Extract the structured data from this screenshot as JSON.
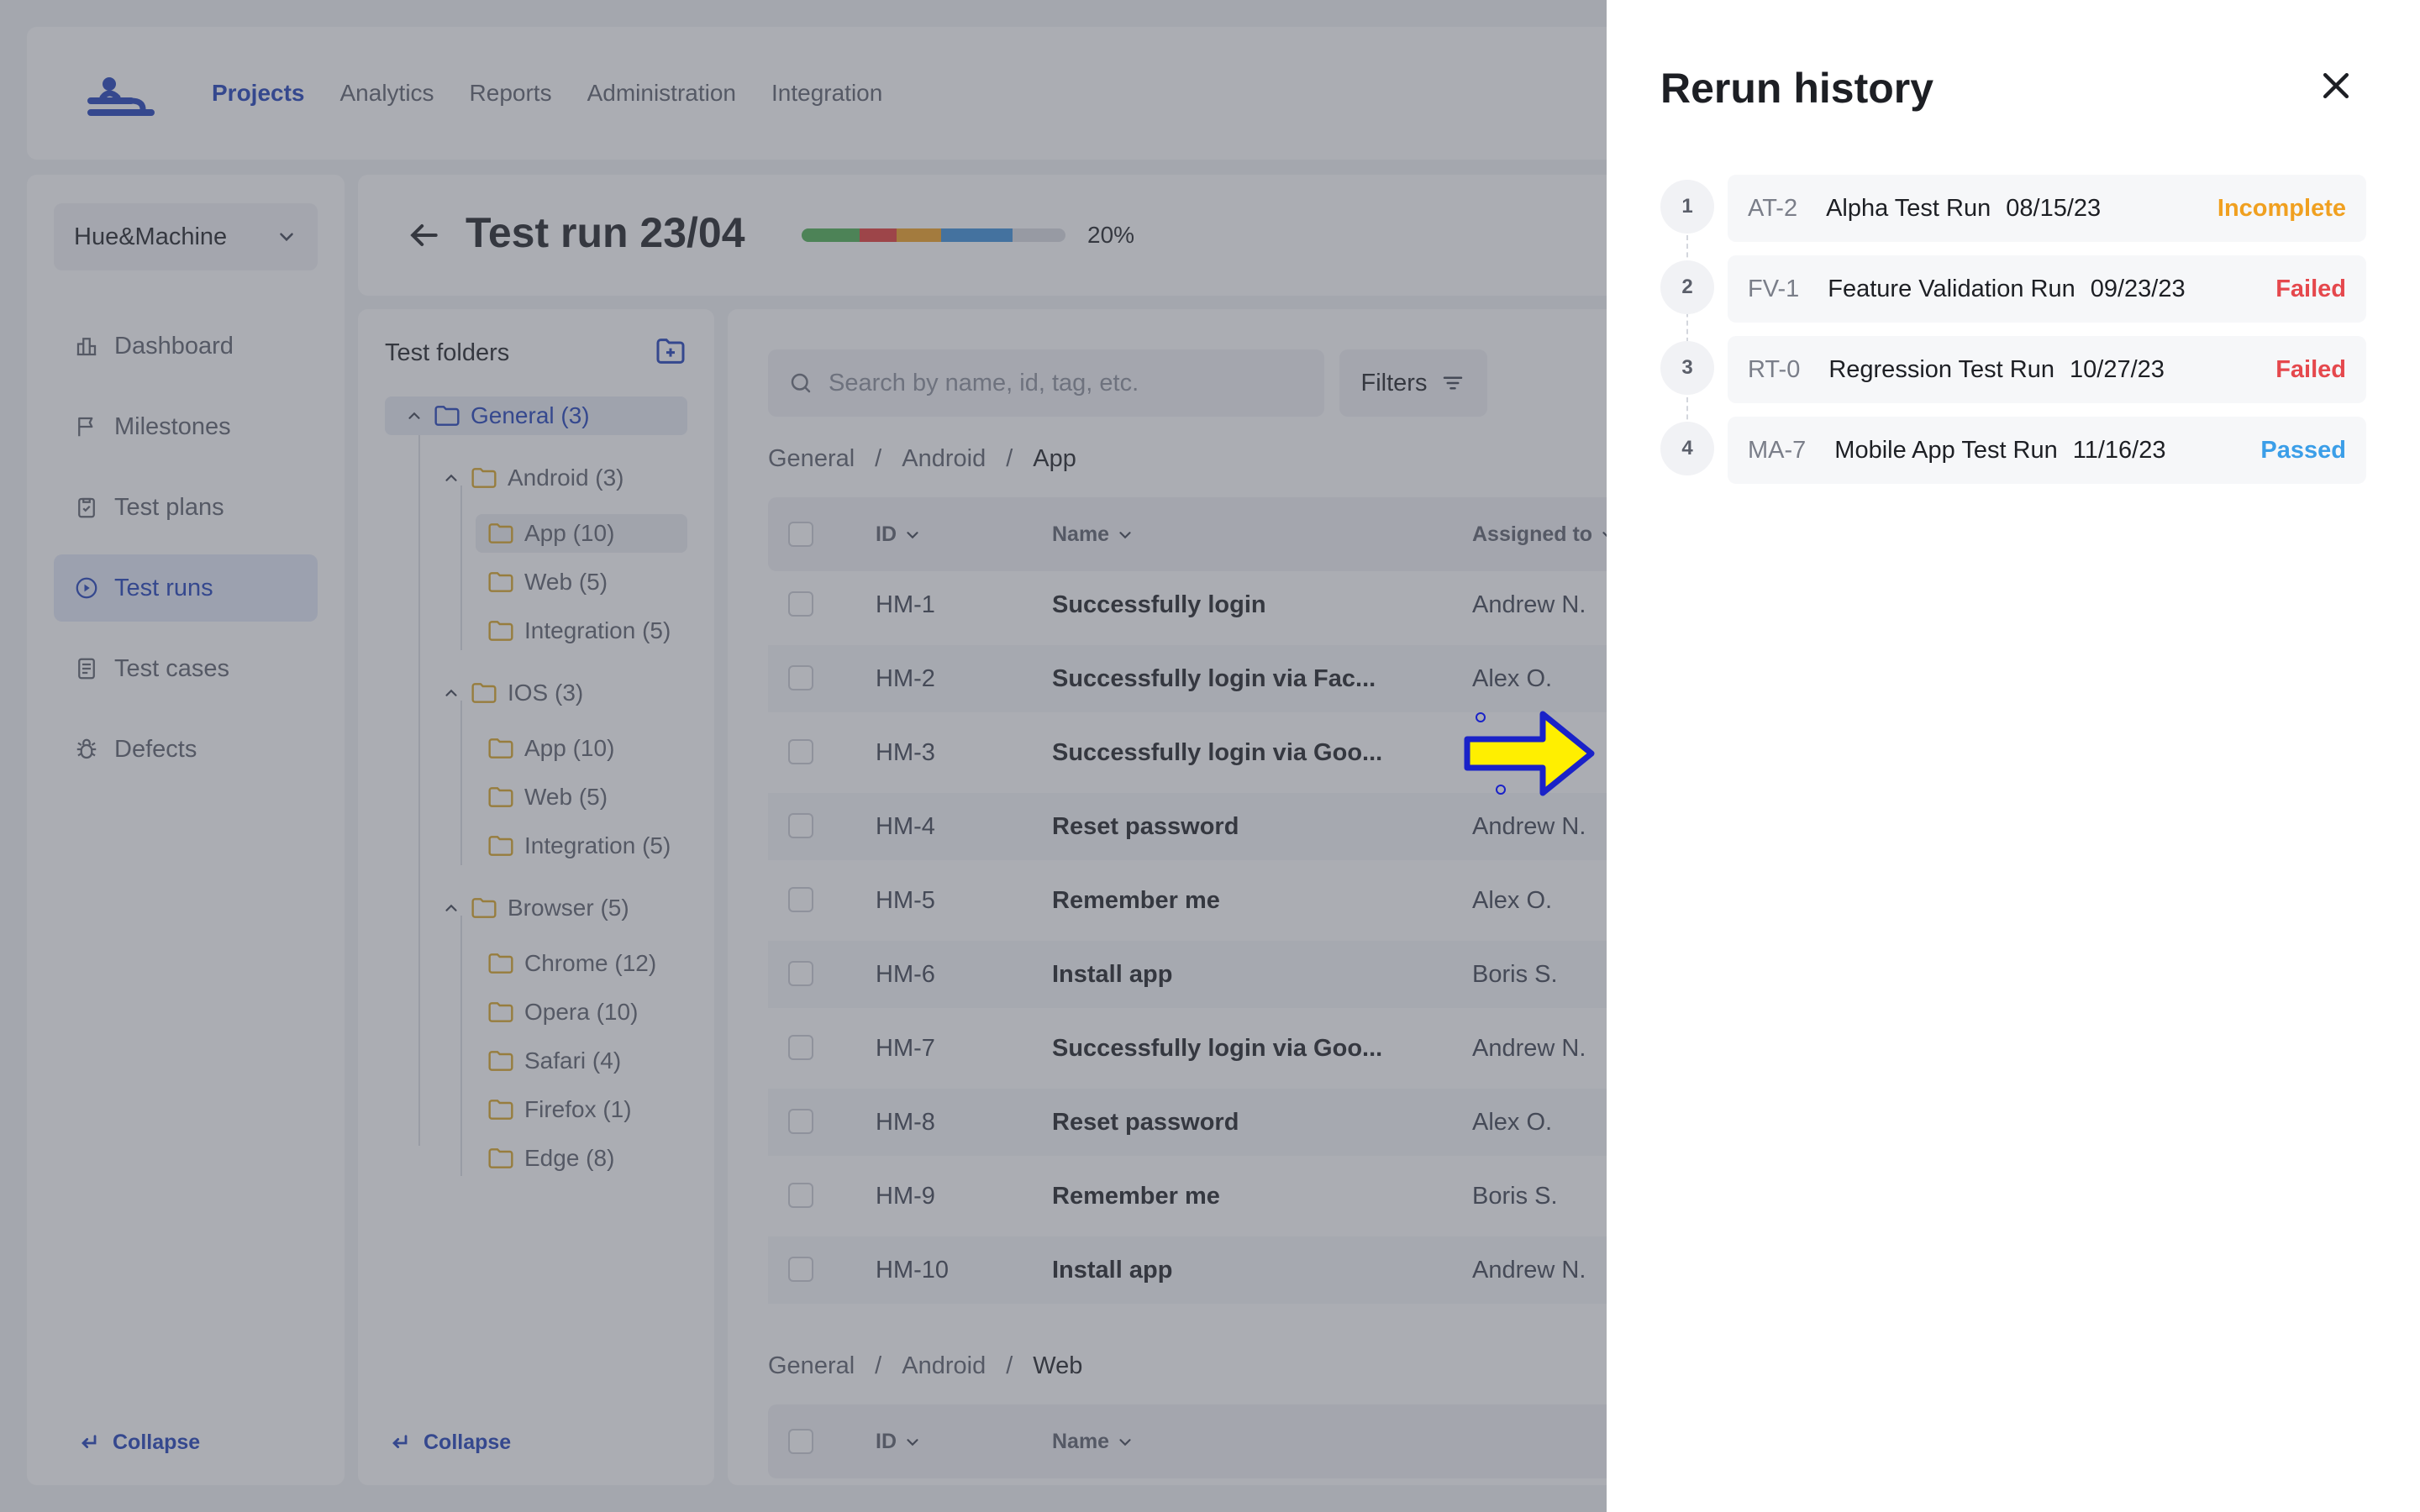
{
  "nav": {
    "items": [
      {
        "label": "Projects",
        "active": true
      },
      {
        "label": "Analytics"
      },
      {
        "label": "Reports"
      },
      {
        "label": "Administration"
      },
      {
        "label": "Integration"
      }
    ]
  },
  "sidebar": {
    "workspace": "Hue&Machine",
    "items": [
      {
        "label": "Dashboard",
        "icon": "dashboard-icon"
      },
      {
        "label": "Milestones",
        "icon": "flag-icon"
      },
      {
        "label": "Test plans",
        "icon": "clipboard-icon"
      },
      {
        "label": "Test runs",
        "icon": "play-circle-icon",
        "active": true
      },
      {
        "label": "Test cases",
        "icon": "document-icon"
      },
      {
        "label": "Defects",
        "icon": "bug-icon"
      }
    ],
    "collapse_label": "Collapse"
  },
  "run": {
    "title": "Test run 23/04",
    "progress_percent": 20,
    "progress_label": "20%",
    "progress_segments": [
      {
        "color": "#4caf50",
        "fraction": 0.22
      },
      {
        "color": "#e53935",
        "fraction": 0.14
      },
      {
        "color": "#f0a020",
        "fraction": 0.17
      },
      {
        "color": "#3b8ed8",
        "fraction": 0.27
      }
    ]
  },
  "folders": {
    "title": "Test folders",
    "collapse_label": "Collapse",
    "tree": {
      "root": "General (3)",
      "android": "Android (3)",
      "android_app": "App (10)",
      "android_web": "Web (5)",
      "android_integration": "Integration (5)",
      "ios": "IOS (3)",
      "ios_app": "App (10)",
      "ios_web": "Web (5)",
      "ios_integration": "Integration (5)",
      "browser": "Browser (5)",
      "chrome": "Chrome (12)",
      "opera": "Opera (10)",
      "safari": "Safari (4)",
      "firefox": "Firefox (1)",
      "edge": "Edge (8)"
    }
  },
  "table": {
    "search_placeholder": "Search by name, id, tag, etc.",
    "filters_label": "Filters",
    "breadcrumb1": {
      "a": "General",
      "sep1": "/",
      "b": "Android",
      "sep2": "/",
      "c": "App"
    },
    "breadcrumb2": {
      "a": "General",
      "sep1": "/",
      "b": "Android",
      "sep2": "/",
      "c": "Web"
    },
    "headers": {
      "id": "ID",
      "name": "Name",
      "assigned": "Assigned to"
    },
    "rows": [
      {
        "id": "HM-1",
        "name": "Successfully login",
        "assignee": "Andrew N."
      },
      {
        "id": "HM-2",
        "name": "Successfully login via Fac...",
        "assignee": "Alex O."
      },
      {
        "id": "HM-3",
        "name": "Successfully login via Goo...",
        "assignee": ""
      },
      {
        "id": "HM-4",
        "name": "Reset password",
        "assignee": "Andrew N."
      },
      {
        "id": "HM-5",
        "name": "Remember me",
        "assignee": "Alex O."
      },
      {
        "id": "HM-6",
        "name": "Install app",
        "assignee": "Boris S."
      },
      {
        "id": "HM-7",
        "name": "Successfully login via Goo...",
        "assignee": "Andrew N."
      },
      {
        "id": "HM-8",
        "name": "Reset password",
        "assignee": "Alex O."
      },
      {
        "id": "HM-9",
        "name": "Remember me",
        "assignee": "Boris S."
      },
      {
        "id": "HM-10",
        "name": "Install app",
        "assignee": "Andrew N."
      }
    ]
  },
  "drawer": {
    "title": "Rerun history",
    "reruns": [
      {
        "num": "1",
        "code": "AT-2",
        "name": "Alpha Test Run",
        "date": "08/15/23",
        "status": "Incomplete",
        "status_color": "#f0a020"
      },
      {
        "num": "2",
        "code": "FV-1",
        "name": "Feature Validation Run",
        "date": "09/23/23",
        "status": "Failed",
        "status_color": "#e5484d"
      },
      {
        "num": "3",
        "code": "RT-0",
        "name": "Regression Test Run",
        "date": "10/27/23",
        "status": "Failed",
        "status_color": "#e5484d"
      },
      {
        "num": "4",
        "code": "MA-7",
        "name": "Mobile App Test Run",
        "date": "11/16/23",
        "status": "Passed",
        "status_color": "#3b9ee8"
      }
    ]
  },
  "colors": {
    "accent": "#1d3fb8",
    "pointer": "#ffef00"
  }
}
